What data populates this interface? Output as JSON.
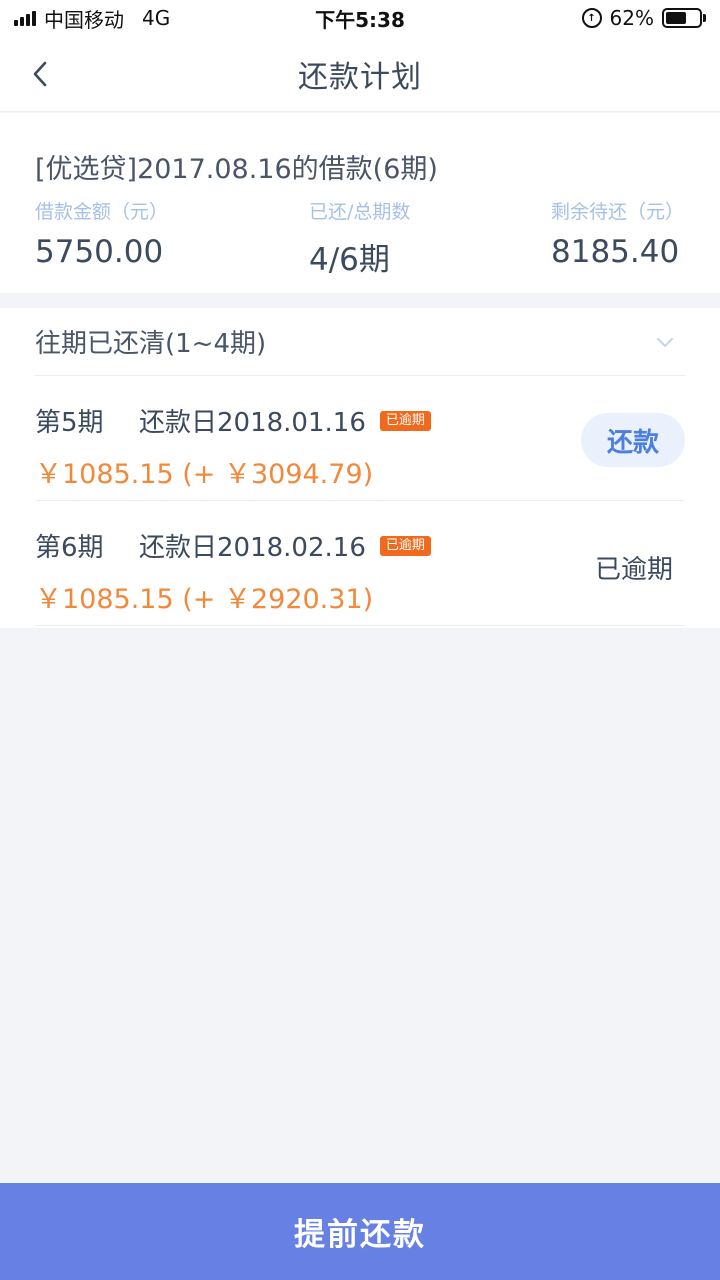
{
  "status_bar": {
    "carrier": "中国移动",
    "network": "4G",
    "time": "下午5:38",
    "battery": "62%",
    "battery_level": 0.62
  },
  "nav": {
    "title": "还款计划",
    "back_icon": "chevron-left-icon"
  },
  "loan": {
    "title": "[优选贷]2017.08.16的借款(6期)",
    "stats": [
      {
        "label": "借款金额（元）",
        "value": "5750.00"
      },
      {
        "label": "已还/总期数",
        "value": "4/6期"
      },
      {
        "label": "剩余待还（元）",
        "value": "8185.40"
      }
    ]
  },
  "plan": {
    "paid_label": "往期已还清(1~4期)",
    "expand_icon": "chevron-down-icon",
    "periods": [
      {
        "period": "第5期",
        "due_date": "还款日2018.01.16",
        "tag": "已逾期",
        "amount": "￥1085.15 (+ ￥3094.79)",
        "action": "还款"
      },
      {
        "period": "第6期",
        "due_date": "还款日2018.02.16",
        "tag": "已逾期",
        "amount": "￥1085.15 (+ ￥2920.31)",
        "status": "已逾期"
      }
    ]
  },
  "footer": {
    "prepay_label": "提前还款"
  },
  "colors": {
    "accent": "#6680e3",
    "overdue_tag": "#f06a1e",
    "amount": "#f2883a",
    "label_blue": "#a7c1e6"
  }
}
